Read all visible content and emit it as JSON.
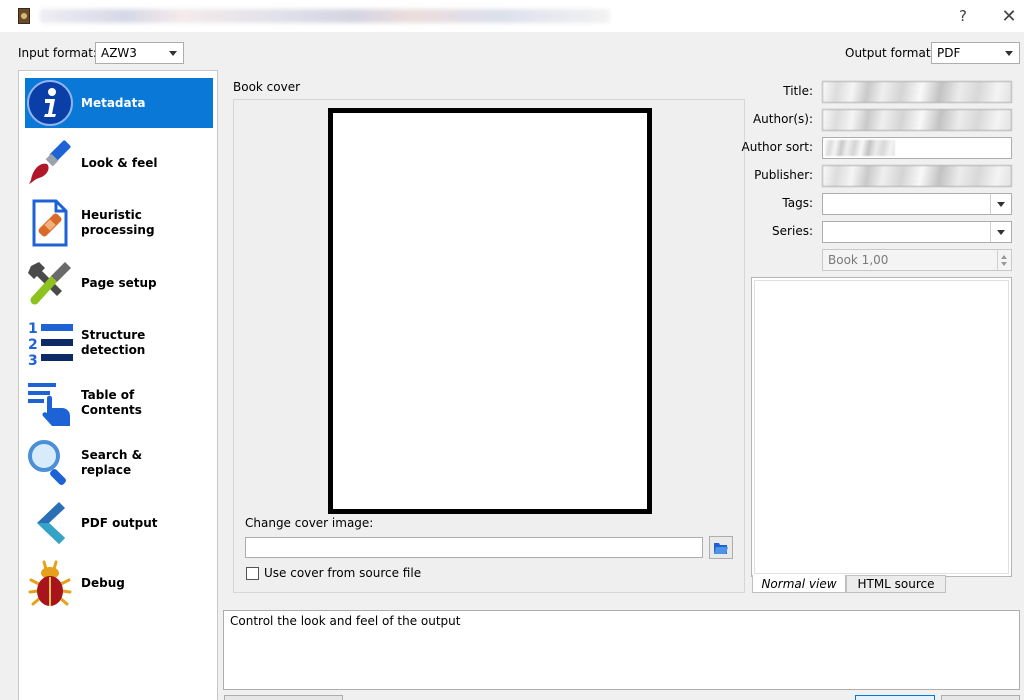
{
  "window": {
    "help_glyph": "?",
    "close_glyph": "✕"
  },
  "formats": {
    "input_label": "Input format:",
    "input_value": "AZW3",
    "output_label": "Output format:",
    "output_value": "PDF"
  },
  "sidebar": {
    "items": [
      {
        "label_line1": "Metadata",
        "label_line2": "",
        "icon": "info-icon"
      },
      {
        "label_line1": "Look & feel",
        "label_line2": "",
        "icon": "paintbrush-icon"
      },
      {
        "label_line1": "Heuristic",
        "label_line2": "processing",
        "icon": "document-bandage-icon"
      },
      {
        "label_line1": "Page setup",
        "label_line2": "",
        "icon": "wrench-screwdriver-icon"
      },
      {
        "label_line1": "Structure",
        "label_line2": "detection",
        "icon": "numbered-list-icon"
      },
      {
        "label_line1": "Table of",
        "label_line2": "Contents",
        "icon": "toc-hand-icon"
      },
      {
        "label_line1": "Search &",
        "label_line2": "replace",
        "icon": "magnifier-icon"
      },
      {
        "label_line1": "PDF output",
        "label_line2": "",
        "icon": "chevron-left-icon"
      },
      {
        "label_line1": "Debug",
        "label_line2": "",
        "icon": "bug-icon"
      }
    ],
    "selected_index": 0
  },
  "cover": {
    "group_title": "Book cover",
    "change_label": "Change cover image:",
    "path_value": "",
    "use_source_label": "Use cover from source file",
    "use_source_checked": false
  },
  "metadata": {
    "title_label": "Title:",
    "authors_label": "Author(s):",
    "author_sort_label": "Author sort:",
    "publisher_label": "Publisher:",
    "tags_label": "Tags:",
    "series_label": "Series:",
    "series_index": "Book 1,00",
    "tab_normal": "Normal view",
    "tab_html": "HTML source"
  },
  "help_text": "Control the look and feel of the output",
  "colors": {
    "selection": "#0a78d7",
    "background": "#f0f0f0"
  }
}
